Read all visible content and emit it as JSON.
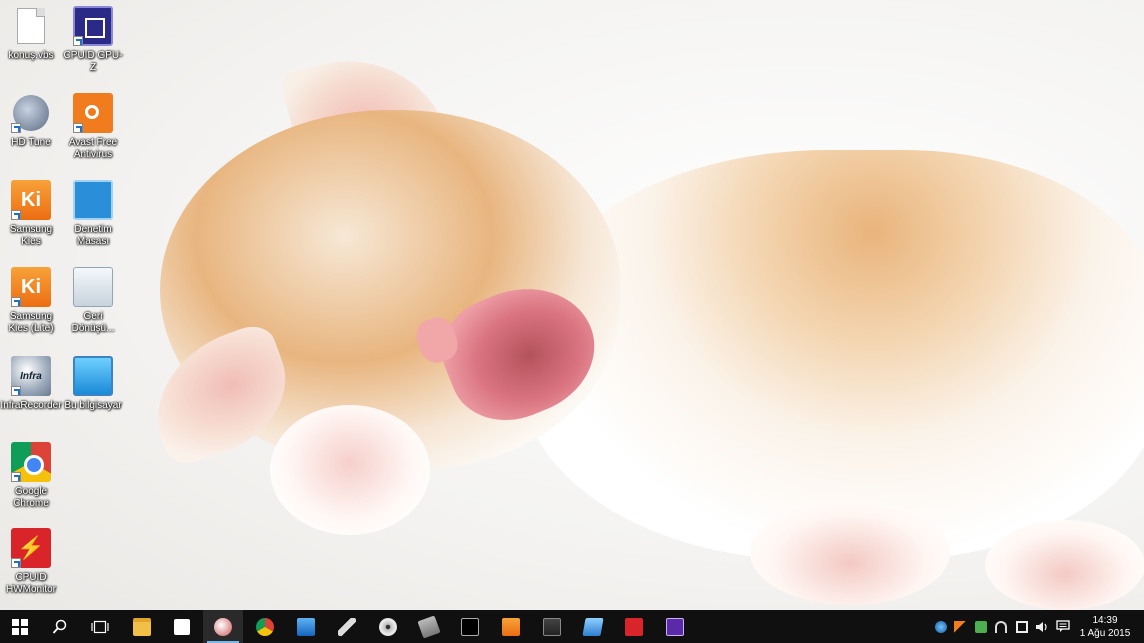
{
  "desktop_icons": [
    {
      "id": "konusvbs",
      "label": "konuş.vbs",
      "icon": "document-icon"
    },
    {
      "id": "gpuz",
      "label": "CPUID GPU-Z",
      "icon": "gpu-z-icon"
    },
    {
      "id": "hdtune",
      "label": "HD Tune",
      "icon": "hd-tune-icon"
    },
    {
      "id": "avast",
      "label": "Avast Free Antivirus",
      "icon": "avast-icon"
    },
    {
      "id": "kies",
      "label": "Samsung Kies",
      "icon": "samsung-kies-icon",
      "glyph": "Ki"
    },
    {
      "id": "control",
      "label": "Denetim Masası",
      "icon": "control-panel-icon"
    },
    {
      "id": "kieslite",
      "label": "Samsung Kies (Lite)",
      "icon": "samsung-kies-lite-icon",
      "glyph": "Ki"
    },
    {
      "id": "recycle",
      "label": "Geri Dönüşü...",
      "icon": "recycle-bin-icon"
    },
    {
      "id": "infra",
      "label": "InfraRecorder",
      "icon": "infrarecorder-icon",
      "glyph": "Infra"
    },
    {
      "id": "pc",
      "label": "Bu bilgisayar",
      "icon": "computer-icon"
    },
    {
      "id": "chrome",
      "label": "Google Chrome",
      "icon": "chrome-icon"
    },
    {
      "id": "hwmon",
      "label": "CPUID HWMonitor",
      "icon": "hwmonitor-icon",
      "glyph": "⚡"
    }
  ],
  "taskbar": {
    "pinned": [
      {
        "name": "start-button",
        "icon": "windows-logo-icon"
      },
      {
        "name": "search-button",
        "icon": "search-icon"
      },
      {
        "name": "task-view-button",
        "icon": "task-view-icon"
      },
      {
        "name": "file-explorer-button",
        "icon": "folder-icon"
      },
      {
        "name": "store-button",
        "icon": "store-icon"
      },
      {
        "name": "paint-app-button",
        "icon": "paint-icon",
        "active": true
      },
      {
        "name": "chrome-taskbar-button",
        "icon": "chrome-icon"
      },
      {
        "name": "downloader-button",
        "icon": "download-icon"
      },
      {
        "name": "pen-tool-button",
        "icon": "pen-icon"
      },
      {
        "name": "disc-app-button",
        "icon": "disc-icon"
      },
      {
        "name": "hd-tune-taskbar-button",
        "icon": "drive-icon"
      },
      {
        "name": "cmd-button",
        "icon": "terminal-icon"
      },
      {
        "name": "kies-taskbar-button",
        "icon": "samsung-kies-icon"
      },
      {
        "name": "gpu-app-button",
        "icon": "gpu-card-icon"
      },
      {
        "name": "remote-app-button",
        "icon": "window-icon"
      },
      {
        "name": "hwmonitor-taskbar-button",
        "icon": "hwmonitor-icon"
      },
      {
        "name": "gpuz-taskbar-button",
        "icon": "gpu-z-icon"
      }
    ],
    "tray": [
      {
        "name": "tray-app-icon",
        "icon": "globe-icon"
      },
      {
        "name": "tray-avast-icon",
        "icon": "avast-icon"
      },
      {
        "name": "tray-usb-icon",
        "icon": "usb-icon"
      },
      {
        "name": "tray-bluetooth-icon",
        "icon": "wifi-icon"
      },
      {
        "name": "tray-network-icon",
        "icon": "network-icon"
      },
      {
        "name": "tray-volume-icon",
        "icon": "volume-icon"
      }
    ],
    "clock": {
      "time": "14:39",
      "date": "1 Ağu 2015"
    },
    "notification_icon": "action-center-icon"
  },
  "colors": {
    "taskbar": "#101010",
    "accent": "#76b9ed"
  }
}
